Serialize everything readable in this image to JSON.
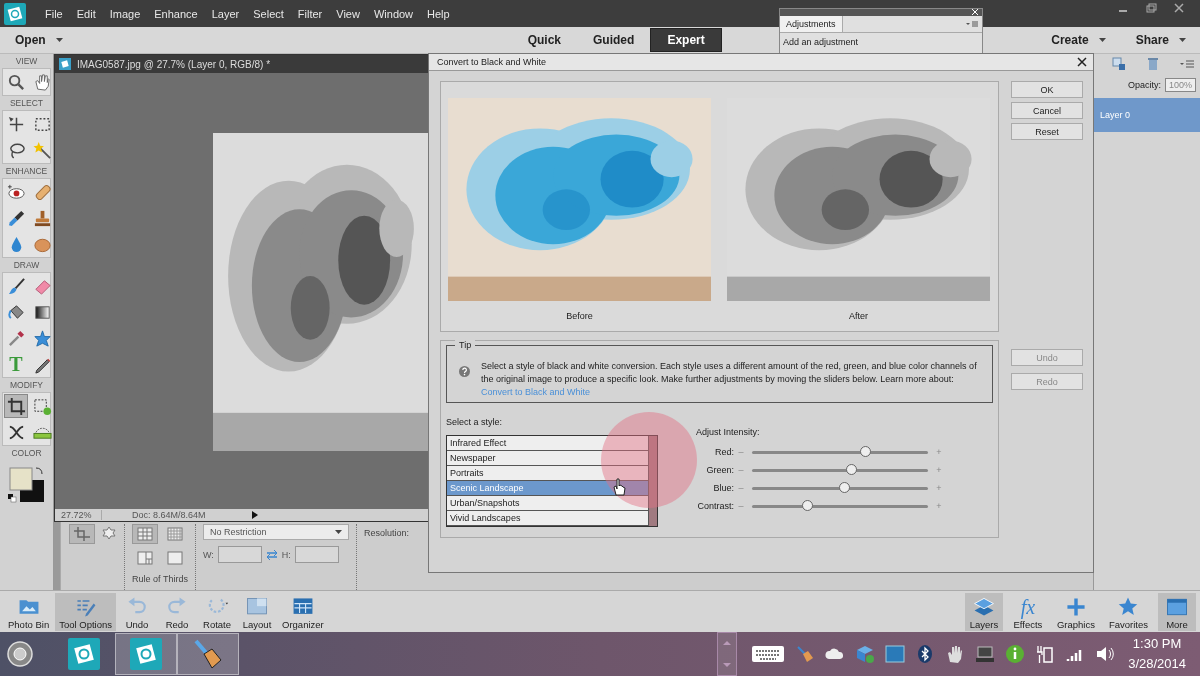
{
  "menubar": {
    "items": [
      "File",
      "Edit",
      "Image",
      "Enhance",
      "Layer",
      "Select",
      "Filter",
      "View",
      "Window",
      "Help"
    ]
  },
  "modebar": {
    "open": "Open",
    "modes": [
      {
        "label": "Quick",
        "selected": false
      },
      {
        "label": "Guided",
        "selected": false
      },
      {
        "label": "Expert",
        "selected": true
      }
    ],
    "create": "Create",
    "share": "Share"
  },
  "adjustments_panel": {
    "tab": "Adjustments",
    "text": "Add an adjustment"
  },
  "toolbox": {
    "sections": [
      {
        "title": "VIEW",
        "tools": [
          {
            "kind": "zoom",
            "selected": false
          },
          {
            "kind": "hand",
            "selected": false
          }
        ]
      },
      {
        "title": "SELECT",
        "tools": [
          {
            "kind": "move",
            "selected": false
          },
          {
            "kind": "marquee",
            "selected": false
          },
          {
            "kind": "lasso",
            "selected": false
          },
          {
            "kind": "wand",
            "selected": false
          }
        ]
      },
      {
        "title": "ENHANCE",
        "tools": [
          {
            "kind": "redeye",
            "selected": false
          },
          {
            "kind": "healing",
            "selected": false
          },
          {
            "kind": "smartbrush",
            "selected": false
          },
          {
            "kind": "stamp",
            "selected": false
          },
          {
            "kind": "blur",
            "selected": false
          },
          {
            "kind": "sponge",
            "selected": false
          }
        ]
      },
      {
        "title": "DRAW",
        "tools": [
          {
            "kind": "brush",
            "selected": false
          },
          {
            "kind": "eraser",
            "selected": false
          },
          {
            "kind": "bucket",
            "selected": false
          },
          {
            "kind": "gradient",
            "selected": false
          },
          {
            "kind": "eyedropper",
            "selected": false
          },
          {
            "kind": "shape",
            "selected": false
          },
          {
            "kind": "text",
            "glyph": "T",
            "selected": false
          },
          {
            "kind": "pencil",
            "selected": false
          }
        ]
      },
      {
        "title": "MODIFY",
        "tools": [
          {
            "kind": "crop",
            "selected": true
          },
          {
            "kind": "recompose",
            "selected": false
          },
          {
            "kind": "contentmove",
            "selected": false
          },
          {
            "kind": "straighten",
            "selected": false
          }
        ]
      }
    ],
    "color": {
      "title": "COLOR"
    }
  },
  "document": {
    "title": "IMAG0587.jpg @ 27.7% (Layer 0, RGB/8) *",
    "zoom": "27.72%",
    "doc_info": "Doc: 8.64M/8.64M"
  },
  "tool_options": {
    "overlay_label": "Rule of Thirds",
    "ratio": "No Restriction",
    "w_label": "W:",
    "h_label": "H:",
    "resolution_label": "Resolution:"
  },
  "layers_panel": {
    "opacity_label": "Opacity:",
    "opacity": "100%",
    "layers": [
      {
        "name": "Layer 0",
        "selected": true
      }
    ]
  },
  "dialog": {
    "title": "Convert to Black and White",
    "before_label": "Before",
    "after_label": "After",
    "buttons": [
      "OK",
      "Cancel",
      "Reset"
    ],
    "history_buttons": [
      {
        "label": "Undo",
        "disabled": true
      },
      {
        "label": "Redo",
        "disabled": true
      }
    ],
    "tip": {
      "legend": "Tip",
      "text": "Select a style of black and white conversion. Each style uses a different amount of the red, green, and blue color channels of the original image to produce a specific look. Make further adjustments by moving the sliders below. Learn more about:",
      "link": "Convert to Black and White"
    },
    "style_label": "Select a style:",
    "styles": [
      {
        "name": "Infrared Effect",
        "selected": false
      },
      {
        "name": "Newspaper",
        "selected": false
      },
      {
        "name": "Portraits",
        "selected": false
      },
      {
        "name": "Scenic Landscape",
        "selected": true
      },
      {
        "name": "Urban/Snapshots",
        "selected": false
      },
      {
        "name": "Vivid Landscapes",
        "selected": false
      }
    ],
    "intensity_label": "Adjust Intensity:",
    "min_sign": "–",
    "max_sign": "+",
    "sliders": [
      {
        "name": "Red:",
        "level": 0.65
      },
      {
        "name": "Green:",
        "level": 0.57
      },
      {
        "name": "Blue:",
        "level": 0.53
      },
      {
        "name": "Contrast:",
        "level": 0.32
      }
    ]
  },
  "bottom_bar": {
    "left": [
      {
        "kind": "photobin",
        "label": "Photo Bin",
        "selected": false
      },
      {
        "kind": "tooloptions",
        "label": "Tool Options",
        "selected": true
      },
      {
        "kind": "undo",
        "label": "Undo",
        "selected": false
      },
      {
        "kind": "redo",
        "label": "Redo",
        "selected": false
      },
      {
        "kind": "rotate",
        "label": "Rotate",
        "selected": false
      },
      {
        "kind": "layout",
        "label": "Layout",
        "selected": false
      },
      {
        "kind": "organizer",
        "label": "Organizer",
        "selected": false
      }
    ],
    "right": [
      {
        "kind": "layers",
        "label": "Layers",
        "selected": true
      },
      {
        "kind": "effects",
        "glyph": "fx",
        "label": "Effects",
        "selected": false
      },
      {
        "kind": "graphics",
        "label": "Graphics",
        "selected": false
      },
      {
        "kind": "favorites",
        "label": "Favorites",
        "selected": false
      },
      {
        "kind": "more",
        "label": "More",
        "selected": true
      }
    ]
  },
  "taskbar": {
    "apps": [
      {
        "kind": "editor",
        "selected": false
      },
      {
        "kind": "editor",
        "selected": true
      },
      {
        "kind": "touch",
        "selected": true
      }
    ],
    "time": "1:30 PM",
    "date": "3/28/2014"
  }
}
